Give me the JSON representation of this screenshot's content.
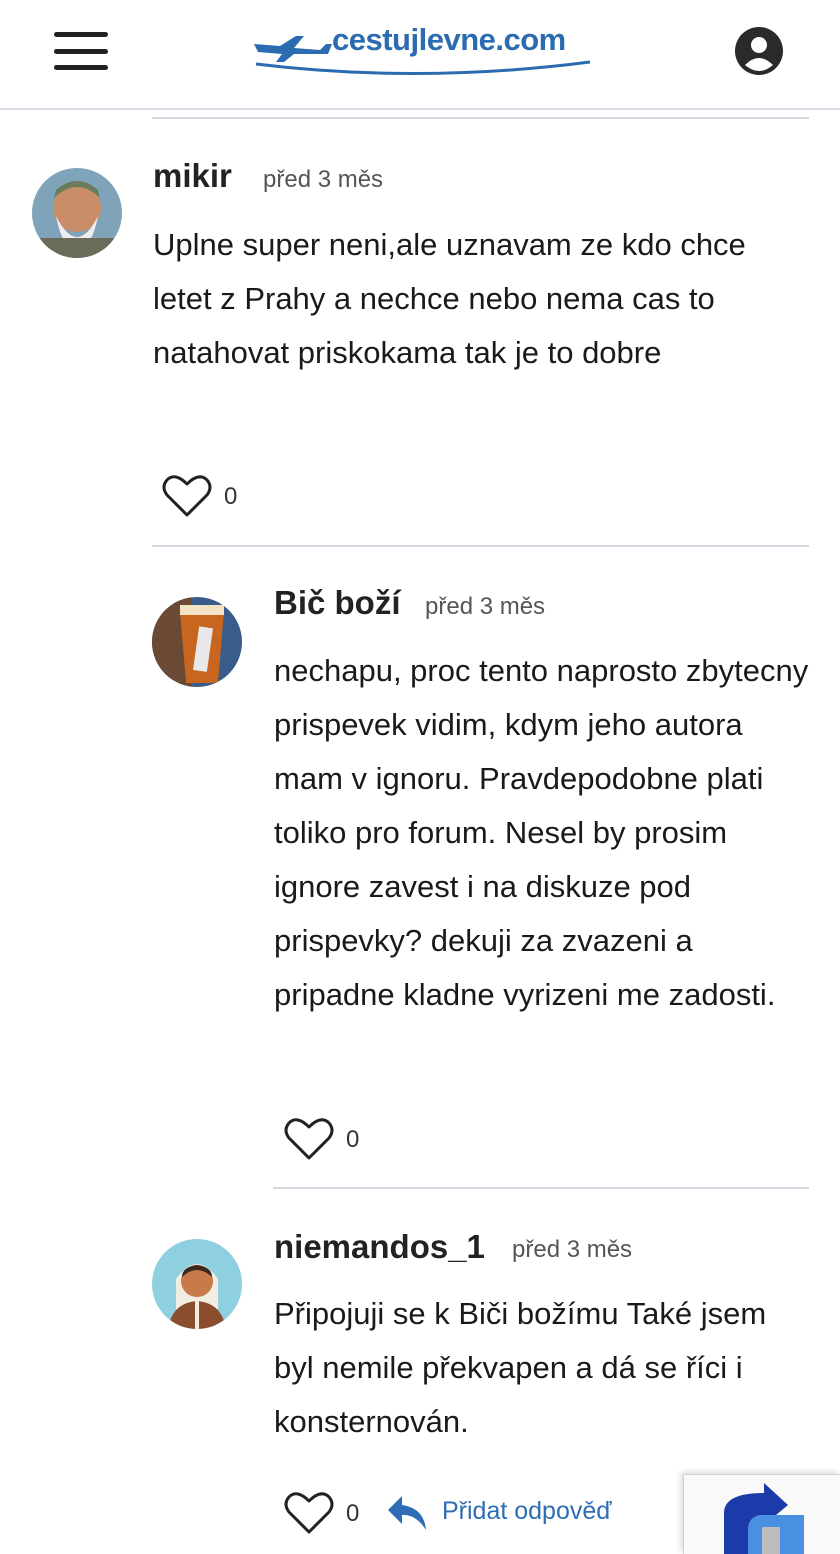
{
  "header": {
    "brand": "cestujlevne.com",
    "menu_icon": "hamburger-menu-icon",
    "account_icon": "user-account-icon"
  },
  "colors": {
    "brand_blue": "#2b6bb0",
    "link_blue": "#2e6db4",
    "divider": "#d5d8e0"
  },
  "comments": [
    {
      "author": "mikir",
      "time": "před 3 měs",
      "text": "Uplne super neni,ale uznavam ze kdo chce letet z Prahy a nechce nebo nema cas to natahovat priskokama tak je to dobre",
      "likes": "0"
    },
    {
      "author": "Bič boží",
      "time": "před 3 měs",
      "text": "nechapu, proc tento naprosto zbytecny prispevek vidim, kdym jeho autora mam v ignoru. Pravdepodobne plati toliko pro forum. Nesel by prosim ignore zavest i na diskuze pod prispevky? dekuji za zvazeni a pripadne kladne vyrizeni me zadosti.",
      "likes": "0"
    },
    {
      "author": "niemandos_1",
      "time": "před 3 měs",
      "text": "Připojuji se k Biči božímu Také jsem byl nemile překvapen a dá se říci i konsternován.",
      "likes": "0",
      "reply_label": "Přidat odpověď"
    }
  ]
}
